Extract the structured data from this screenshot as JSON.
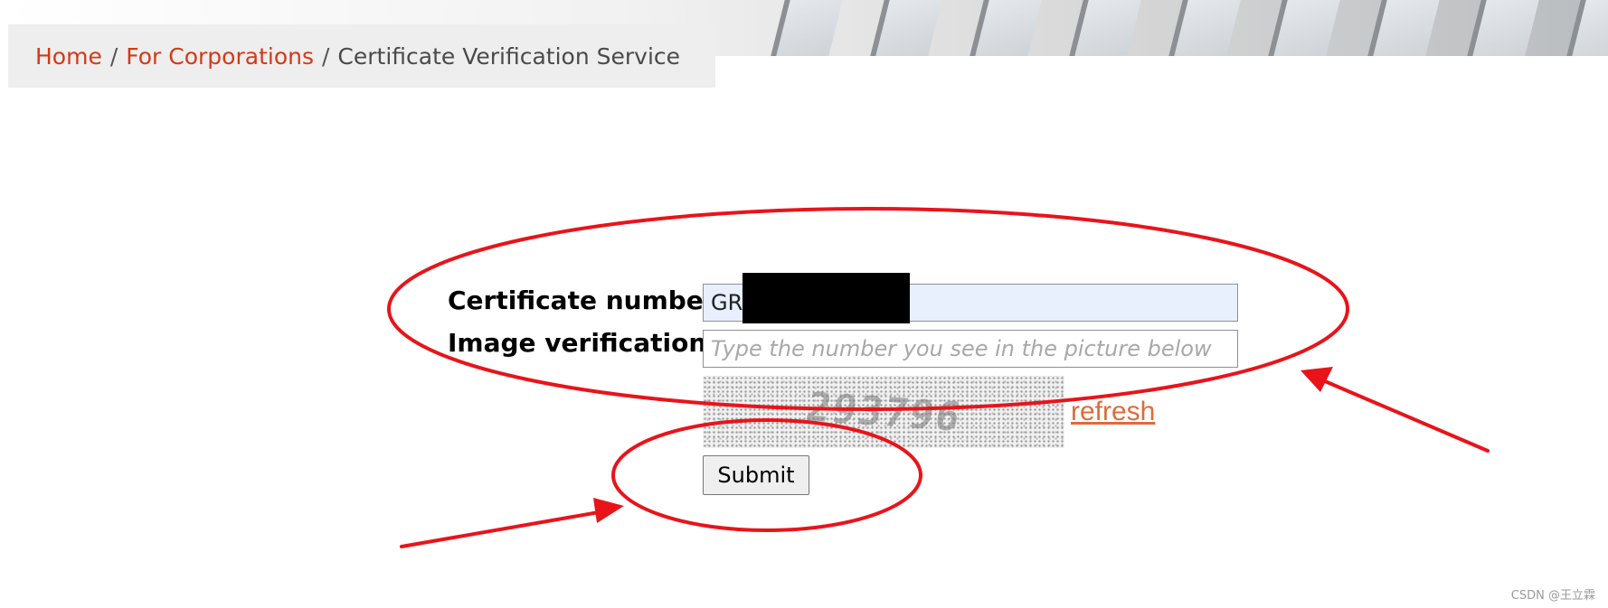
{
  "breadcrumb": {
    "items": [
      "Home",
      "For Corporations",
      "Certificate Verification Service"
    ],
    "separator": "/",
    "link_color": "#d23a17"
  },
  "form": {
    "certificate": {
      "label": "Certificate number",
      "value": "GR",
      "redacted": true
    },
    "image_verification": {
      "label": "Image verification",
      "value": "",
      "placeholder": "Type the number you see in the picture below"
    },
    "captcha": {
      "digits": "293796"
    },
    "refresh_label": "refresh",
    "submit_label": "Submit"
  },
  "annotation": {
    "color": "#e8141a",
    "shapes": [
      "ellipse",
      "ellipse",
      "arrow",
      "arrow"
    ]
  },
  "watermark": "CSDN @王立霖"
}
